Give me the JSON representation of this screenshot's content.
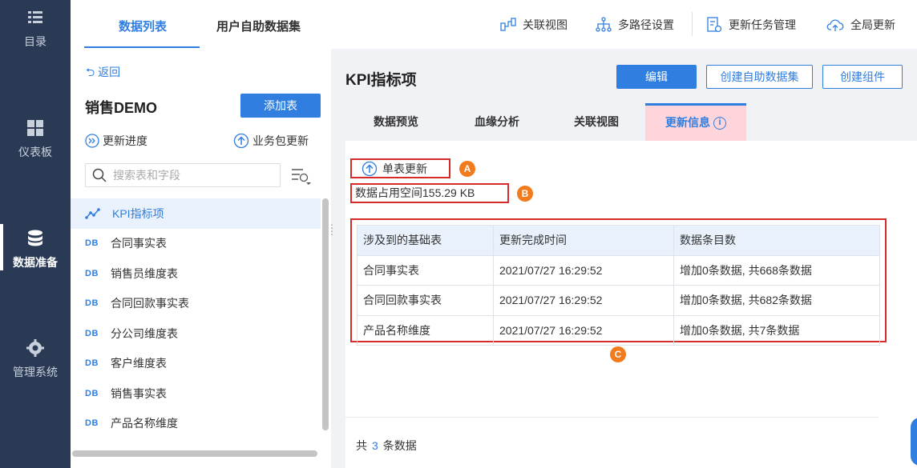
{
  "leftnav": {
    "items": [
      {
        "label": "目录",
        "icon": "menu-list-icon"
      },
      {
        "label": "仪表板",
        "icon": "dashboard-grid-icon"
      },
      {
        "label": "数据准备",
        "icon": "database-icon"
      },
      {
        "label": "管理系统",
        "icon": "gear-icon"
      }
    ]
  },
  "listpanel": {
    "tabs": [
      {
        "label": "数据列表"
      },
      {
        "label": "用户自助数据集"
      }
    ],
    "back_label": "返回",
    "package_title": "销售DEMO",
    "add_button": "添加表",
    "progress_label": "更新进度",
    "package_update_label": "业务包更新",
    "search_placeholder": "搜索表和字段",
    "tables": [
      {
        "label": "KPI指标项",
        "icon": "analysis-icon"
      },
      {
        "label": "合同事实表",
        "icon": "DB"
      },
      {
        "label": "销售员维度表",
        "icon": "DB"
      },
      {
        "label": "合同回款事实表",
        "icon": "DB"
      },
      {
        "label": "分公司维度表",
        "icon": "DB"
      },
      {
        "label": "客户维度表",
        "icon": "DB"
      },
      {
        "label": "销售事实表",
        "icon": "DB"
      },
      {
        "label": "产品名称维度",
        "icon": "DB"
      }
    ]
  },
  "toolbar": {
    "items": [
      {
        "label": "关联视图",
        "icon": "relation-view-icon"
      },
      {
        "label": "多路径设置",
        "icon": "multipath-icon"
      },
      {
        "label": "更新任务管理",
        "icon": "task-manage-icon"
      },
      {
        "label": "全局更新",
        "icon": "cloud-update-icon"
      }
    ]
  },
  "main": {
    "title": "KPI指标项",
    "edit_button": "编辑",
    "create_dataset_button": "创建自助数据集",
    "create_component_button": "创建组件",
    "tabs": [
      {
        "label": "数据预览"
      },
      {
        "label": "血缘分析"
      },
      {
        "label": "关联视图"
      },
      {
        "label": "更新信息"
      }
    ],
    "single_update_label": "单表更新",
    "space_used": "数据占用空间155.29 KB",
    "badges": [
      "A",
      "B",
      "C"
    ],
    "table": {
      "headers": [
        "涉及到的基础表",
        "更新完成时间",
        "数据条目数"
      ],
      "rows": [
        [
          "合同事实表",
          "2021/07/27 16:29:52",
          "增加0条数据, 共668条数据"
        ],
        [
          "合同回款事实表",
          "2021/07/27 16:29:52",
          "增加0条数据, 共682条数据"
        ],
        [
          "产品名称维度",
          "2021/07/27 16:29:52",
          "增加0条数据, 共7条数据"
        ]
      ]
    },
    "total_prefix": "共",
    "total_count": "3",
    "total_suffix": "条数据"
  },
  "colors": {
    "accent": "#2f7ee0",
    "nav_bg": "#2a3a55",
    "highlight_border": "#d52b2b",
    "badge": "#f27b1e",
    "active_tab_bg": "#fdd5da"
  }
}
